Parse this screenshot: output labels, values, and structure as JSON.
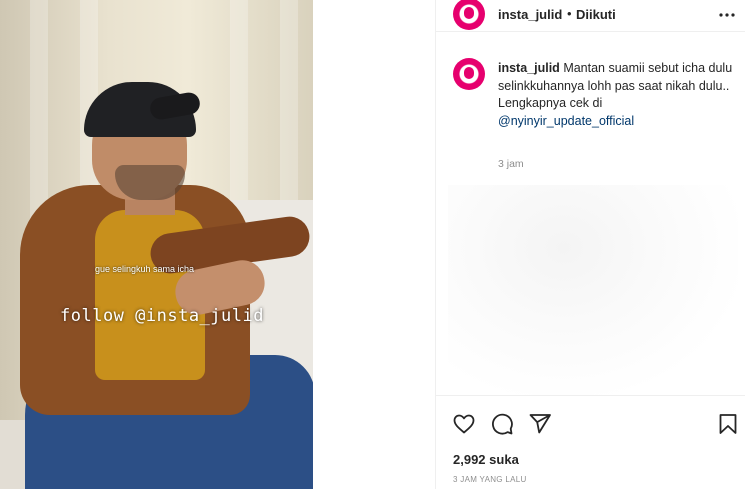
{
  "video": {
    "caption": "gue selingkuh sama icha",
    "watermark": "follow @insta_julid"
  },
  "header": {
    "username": "insta_julid",
    "separator": "•",
    "follow_status": "Diikuti",
    "more_icon": "more-horizontal-icon"
  },
  "comment": {
    "username": "insta_julid",
    "text_line1": "Mantan suamii sebut icha dulu selinkkuhannya lohh pas saat nikah dulu..",
    "text_line2": "Lengkapnya cek di",
    "mention": "@nyinyir_update_official",
    "time": "3 jam"
  },
  "actions": {
    "like_icon": "heart-icon",
    "comment_icon": "comment-icon",
    "share_icon": "send-icon",
    "save_icon": "bookmark-icon",
    "likes_count": "2,992",
    "likes_label": "suka",
    "post_time": "3 JAM YANG LALU"
  },
  "colors": {
    "brand_pink": "#e6006e",
    "mention": "#00376b",
    "muted": "#8e8e8e"
  }
}
